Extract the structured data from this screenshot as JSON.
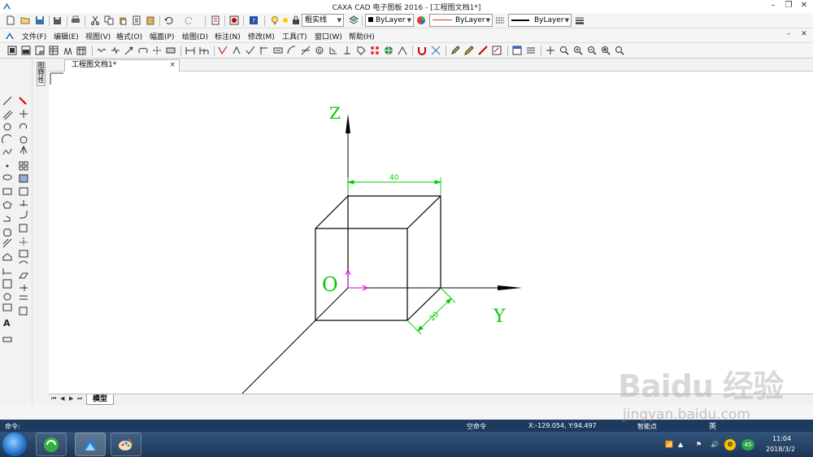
{
  "window": {
    "title": "CAXA CAD 电子图板 2016 - [工程图文档1*]"
  },
  "layer_toolbar": {
    "linetype_combo": "粗实线",
    "color_combo": "ByLayer",
    "linetype2_combo": "ByLayer",
    "linewidth_combo": "ByLayer"
  },
  "menu": {
    "items": [
      {
        "label": "文件(F)"
      },
      {
        "label": "编辑(E)"
      },
      {
        "label": "视图(V)"
      },
      {
        "label": "格式(O)"
      },
      {
        "label": "幅面(P)"
      },
      {
        "label": "绘图(D)"
      },
      {
        "label": "标注(N)"
      },
      {
        "label": "修改(M)"
      },
      {
        "label": "工具(T)"
      },
      {
        "label": "窗口(W)"
      },
      {
        "label": "帮助(H)"
      }
    ]
  },
  "side_tabs": [
    "图库",
    "特性"
  ],
  "document": {
    "tab_label": "工程图文档1*",
    "close": "×"
  },
  "drawing": {
    "axis_z": "Z",
    "axis_y": "Y",
    "origin": "O",
    "dim_top": "40",
    "dim_side": "20",
    "colors": {
      "axis_label": "#00cc00",
      "dimension": "#00cc00",
      "ucs": "#cc00cc",
      "lines": "#000000"
    }
  },
  "layout_tabs": {
    "nav": [
      "⏮",
      "◀",
      "▶",
      "⏭"
    ],
    "model": "模型"
  },
  "status": {
    "command_prompt": "命令:",
    "command_state": "空命令",
    "coords": "X:-129.054, Y:94.497",
    "partial": "智能点"
  },
  "taskbar": {
    "ime": "英",
    "badge": "45",
    "time": "11:04",
    "date": "2018/3/2"
  },
  "watermark": {
    "logo": "Baidu 经验",
    "url": "jingyan.baidu.com"
  }
}
